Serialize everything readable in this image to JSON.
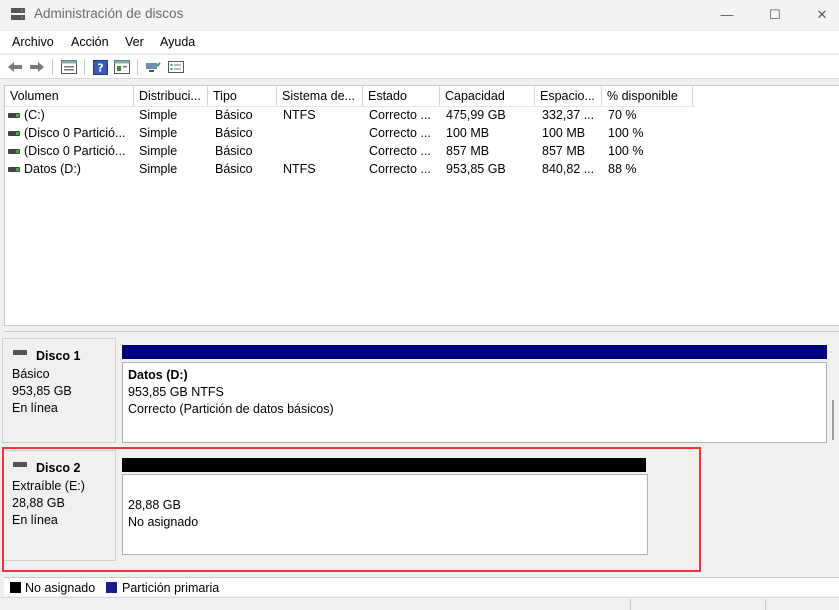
{
  "window": {
    "title": "Administración de discos",
    "minimize_glyph": "—",
    "maximize_glyph": "☐",
    "close_glyph": "✕"
  },
  "menu": [
    "Archivo",
    "Acción",
    "Ver",
    "Ayuda"
  ],
  "toolbar_icons": [
    "back-icon",
    "forward-icon",
    "show-hide-console-tree-icon",
    "help-icon",
    "properties-icon",
    "connect-icon",
    "settings-icon"
  ],
  "volume_list": {
    "columns": [
      "Volumen",
      "Distribuci...",
      "Tipo",
      "Sistema de...",
      "Estado",
      "Capacidad",
      "Espacio...",
      "% disponible"
    ],
    "rows": [
      [
        "(C:)",
        "Simple",
        "Básico",
        "NTFS",
        "Correcto ...",
        "475,99 GB",
        "332,37 ...",
        "70 %"
      ],
      [
        "(Disco 0 Partició...",
        "Simple",
        "Básico",
        "",
        "Correcto ...",
        "100 MB",
        "100 MB",
        "100 %"
      ],
      [
        "(Disco 0 Partició...",
        "Simple",
        "Básico",
        "",
        "Correcto ...",
        "857 MB",
        "857 MB",
        "100 %"
      ],
      [
        "Datos (D:)",
        "Simple",
        "Básico",
        "NTFS",
        "Correcto ...",
        "953,85 GB",
        "840,82 ...",
        "88 %"
      ]
    ]
  },
  "disks": [
    {
      "name": "Disco 1",
      "type": "Básico",
      "size": "953,85 GB",
      "status": "En línea",
      "partition": {
        "title": "Datos  (D:)",
        "line1": "953,85 GB NTFS",
        "line2": "Correcto (Partición de datos básicos)"
      }
    },
    {
      "name": "Disco 2",
      "type": "Extraíble (E:)",
      "size": "28,88 GB",
      "status": "En línea",
      "partition": {
        "line1": "28,88 GB",
        "line2": "No asignado"
      }
    }
  ],
  "legend": [
    {
      "label": "No asignado",
      "color": "#000000"
    },
    {
      "label": "Partición primaria",
      "color": "#1a1a8c"
    }
  ],
  "colors": {
    "primary_partition": "#00007f",
    "unallocated": "#000000",
    "highlight": "#e53939"
  }
}
